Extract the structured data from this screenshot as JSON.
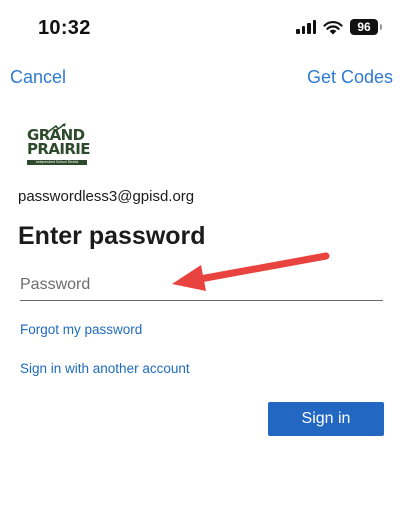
{
  "status_bar": {
    "time": "10:32",
    "battery": "96",
    "icons": [
      "signal-icon",
      "wifi-icon",
      "battery-icon"
    ]
  },
  "nav": {
    "cancel_label": "Cancel",
    "get_codes_label": "Get Codes"
  },
  "logo": {
    "line1": "GRAND",
    "line2": "PRAIRIE",
    "subtitle": "Independent School District"
  },
  "account": {
    "email": "passwordless3@gpisd.org"
  },
  "form": {
    "title": "Enter password",
    "password_placeholder": "Password",
    "password_value": "",
    "forgot_label": "Forgot my password",
    "other_account_label": "Sign in with another account",
    "signin_label": "Sign in"
  },
  "colors": {
    "link": "#2f7ad1",
    "button": "#2268c2",
    "annotation_arrow": "#e8433f",
    "logo": "#2d4a2b"
  }
}
